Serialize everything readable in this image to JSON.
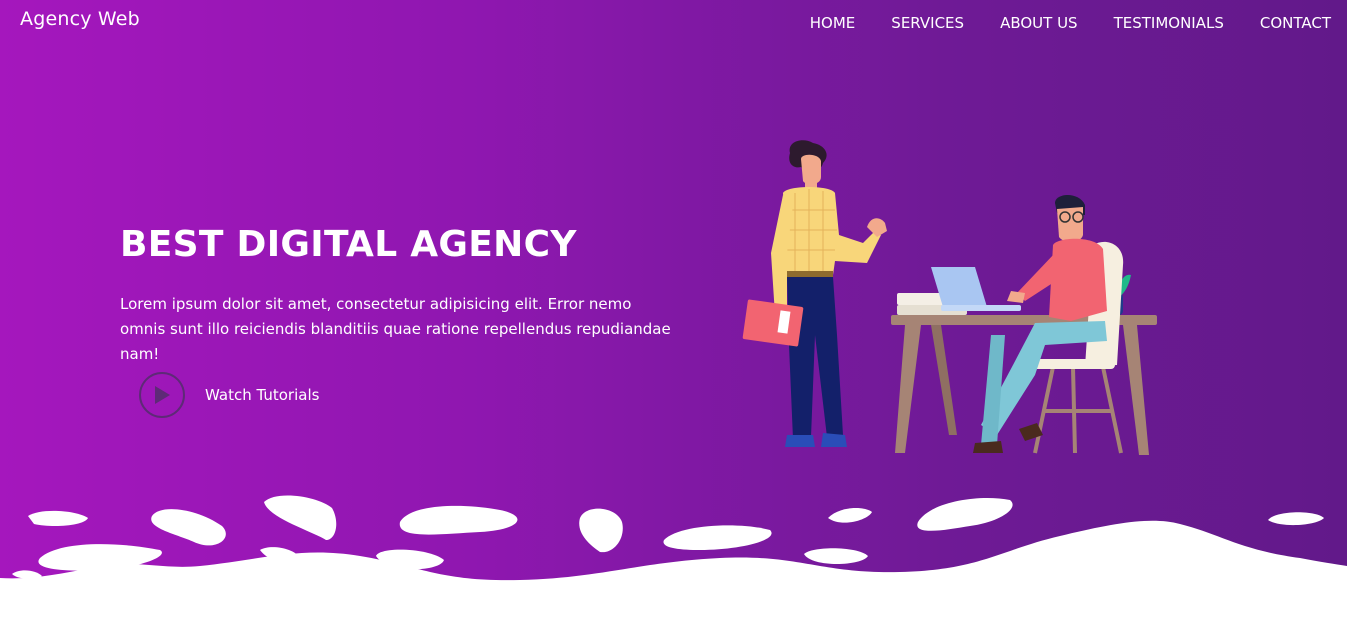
{
  "brand": "Agency Web",
  "nav": [
    {
      "label": "HOME"
    },
    {
      "label": "SERVICES"
    },
    {
      "label": "ABOUT US"
    },
    {
      "label": "TESTIMONIALS"
    },
    {
      "label": "CONTACT"
    }
  ],
  "hero": {
    "title": "BEST DIGITAL AGENCY",
    "description": "Lorem ipsum dolor sit amet, consectetur adipisicing elit. Error nemo omnis sunt illo reiciendis blanditiis quae ratione repellendus repudiandae nam!",
    "cta_label": "Watch Tutorials",
    "cta_icon": "play-icon"
  },
  "colors": {
    "gradient_start": "#a517bd",
    "gradient_end": "#62198a",
    "text": "#ffffff",
    "play_ring": "#5e2a77"
  }
}
